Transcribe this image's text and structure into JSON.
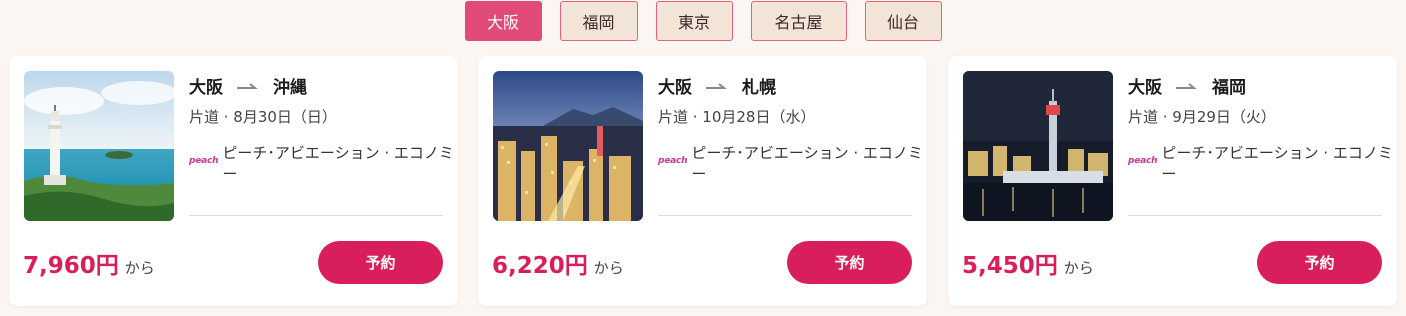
{
  "tabs": [
    {
      "label": "大阪",
      "active": true
    },
    {
      "label": "福岡",
      "active": false
    },
    {
      "label": "東京",
      "active": false
    },
    {
      "label": "名古屋",
      "active": false
    },
    {
      "label": "仙台",
      "active": false
    }
  ],
  "cards": [
    {
      "from": "大阪",
      "to": "沖縄",
      "trip": "片道 · 8月30日（日）",
      "airline_logo": "peach",
      "airline": "ピーチ･アビエーション · エコノミー",
      "price": "7,960円",
      "price_suffix": "から",
      "button": "予約"
    },
    {
      "from": "大阪",
      "to": "札幌",
      "trip": "片道 · 10月28日（水）",
      "airline_logo": "peach",
      "airline": "ピーチ･アビエーション · エコノミー",
      "price": "6,220円",
      "price_suffix": "から",
      "button": "予約"
    },
    {
      "from": "大阪",
      "to": "福岡",
      "trip": "片道 · 9月29日（火）",
      "airline_logo": "peach",
      "airline": "ピーチ･アビエーション · エコノミー",
      "price": "5,450円",
      "price_suffix": "から",
      "button": "予約"
    }
  ],
  "colors": {
    "accent": "#d81e5b",
    "tab_active": "#e24a78",
    "tab_inactive": "#f3e4d8",
    "background": "#fbf6f1"
  }
}
